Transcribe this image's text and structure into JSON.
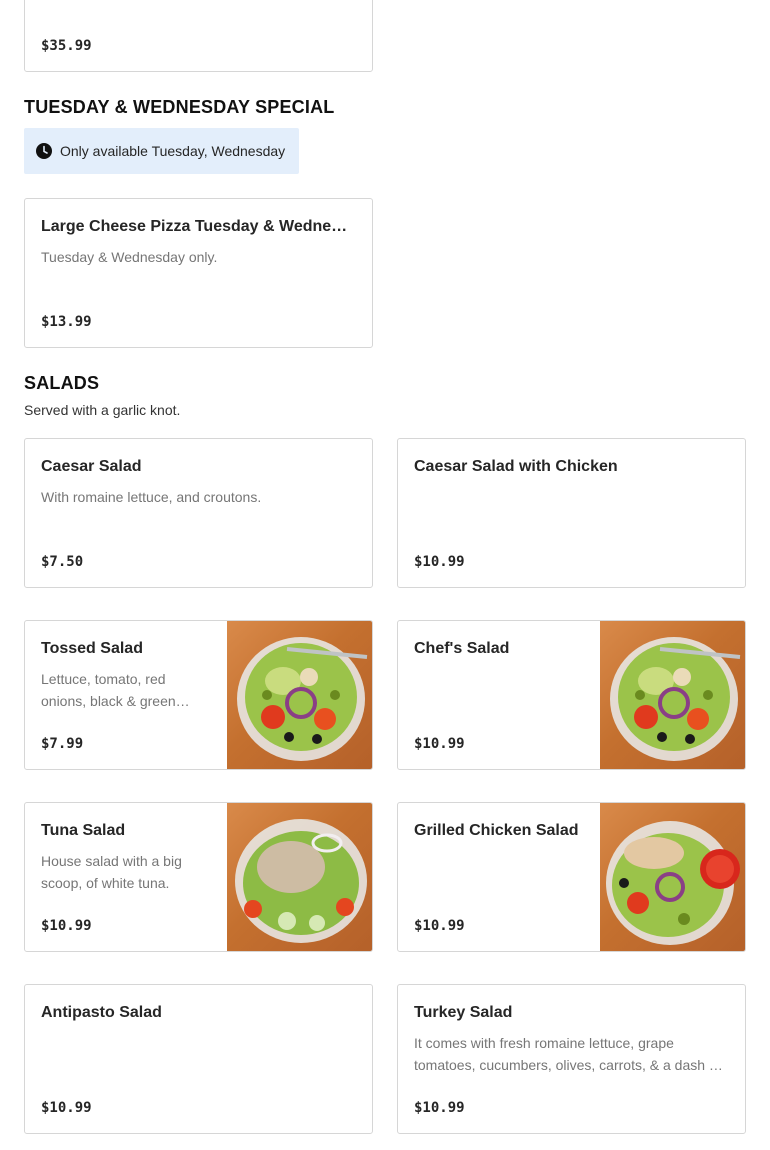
{
  "top_item": {
    "price": "$35.99"
  },
  "special": {
    "title": "TUESDAY & WEDNESDAY SPECIAL",
    "availability": "Only available Tuesday, Wednesday",
    "item": {
      "name": "Large Cheese Pizza Tuesday & Wednesday Special",
      "description": "Tuesday & Wednesday only.",
      "price": "$13.99"
    }
  },
  "salads": {
    "title": "SALADS",
    "subtitle": "Served with a garlic knot.",
    "items": [
      {
        "name": "Caesar Salad",
        "description": "With romaine lettuce, and croutons.",
        "price": "$7.50"
      },
      {
        "name": "Caesar Salad with Chicken",
        "description": "",
        "price": "$10.99"
      },
      {
        "name": "Tossed Salad",
        "description": "Lettuce, tomato, red onions, black & green olives, cucumbers, and carrots.",
        "price": "$7.99",
        "image": "tossed-salad-photo"
      },
      {
        "name": "Chef's Salad",
        "description": "",
        "price": "$10.99",
        "image": "chef-salad-photo"
      },
      {
        "name": "Tuna Salad",
        "description": "House salad with a big scoop, of white tuna.",
        "price": "$10.99",
        "image": "tuna-salad-photo"
      },
      {
        "name": "Grilled Chicken Salad",
        "description": "",
        "price": "$10.99",
        "image": "grilled-chicken-salad-photo"
      },
      {
        "name": "Antipasto Salad",
        "description": "",
        "price": "$10.99"
      },
      {
        "name": "Turkey Salad",
        "description": "It comes with fresh romaine lettuce, grape tomatoes, cucumbers, olives, carrots, & a dash of oil and vinegar.",
        "price": "$10.99"
      }
    ]
  },
  "icons": {
    "availability": "clock-icon"
  },
  "colors": {
    "availability_bg": "#e3eefb",
    "card_border": "#d6d6d6",
    "description": "#767676"
  }
}
